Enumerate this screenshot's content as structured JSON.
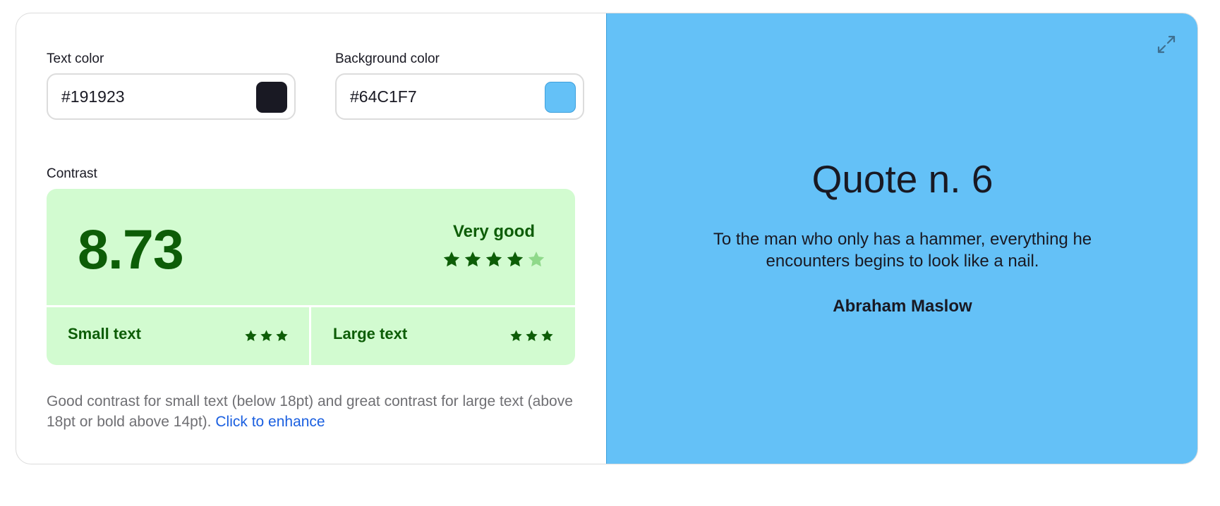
{
  "text_color": {
    "label": "Text color",
    "value": "#191923",
    "swatch": "#191923"
  },
  "background_color": {
    "label": "Background color",
    "value": "#64C1F7",
    "swatch": "#64C1F7"
  },
  "contrast": {
    "label": "Contrast",
    "ratio": "8.73",
    "rating": "Very good",
    "rating_stars": 4,
    "rating_stars_max": 5,
    "small_text": {
      "label": "Small text",
      "stars": 3
    },
    "large_text": {
      "label": "Large text",
      "stars": 3
    },
    "description": "Good contrast for small text (below 18pt) and great contrast for large text (above 18pt or bold above 14pt).",
    "enhance_link": "Click to enhance"
  },
  "preview": {
    "title": "Quote n. 6",
    "quote": "To the man who only has a hammer, everything he encounters begins to look like a nail.",
    "author": "Abraham Maslow",
    "expand_icon": "expand-icon"
  },
  "colors": {
    "good_text": "#0d5d07",
    "good_bg": "#d2fbd0",
    "star_off": "#8fd98a",
    "link": "#1a5fe0"
  }
}
